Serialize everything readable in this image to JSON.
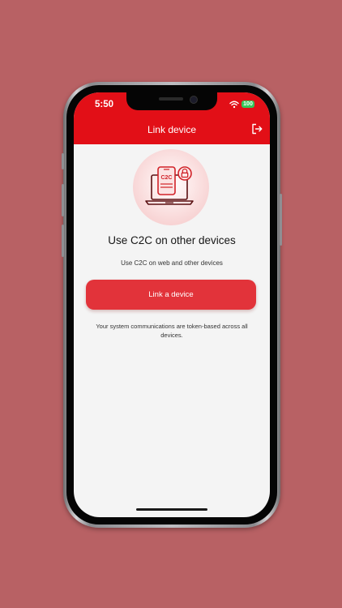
{
  "status_bar": {
    "time": "5:50",
    "battery": "100"
  },
  "header": {
    "title": "Link device",
    "logout_icon": "logout-icon"
  },
  "illustration": {
    "icon": "laptop-phone-lock-icon",
    "badge_text": "C2C"
  },
  "main": {
    "heading": "Use C2C on other devices",
    "subheading": "Use C2C on web and other devices",
    "button_label": "Link a device",
    "footnote": "Your system communications are token-based across all devices."
  },
  "colors": {
    "background": "#b86164",
    "app_bar": "#e20f17",
    "button": "#e2333a",
    "screen_bg": "#f4f4f4"
  }
}
